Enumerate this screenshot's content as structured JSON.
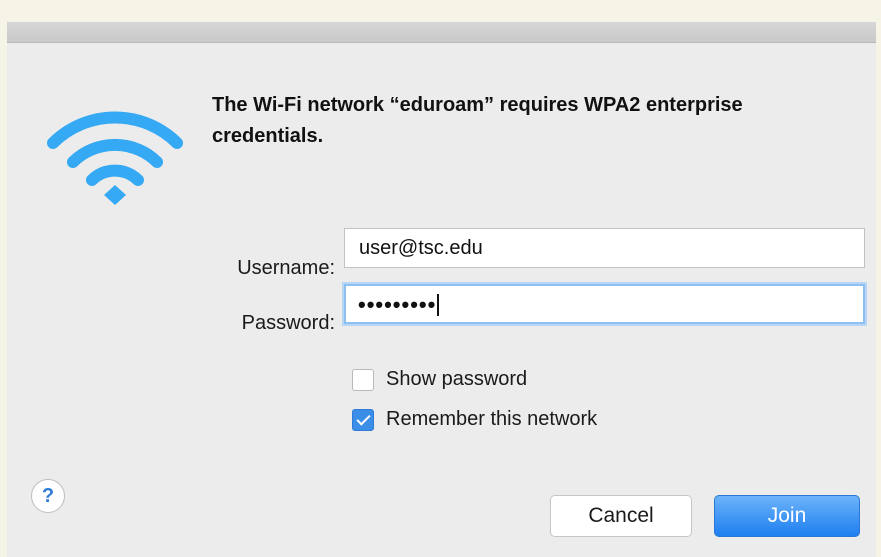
{
  "dialog": {
    "message": "The Wi-Fi network “eduroam” requires WPA2 enterprise credentials.",
    "icon": "wifi-icon"
  },
  "form": {
    "username_label": "Username:",
    "username_value": "user@tsc.edu",
    "password_label": "Password:",
    "password_masked": "•••••••••"
  },
  "options": {
    "show_password_label": "Show password",
    "show_password_checked": false,
    "remember_label": "Remember this network",
    "remember_checked": true
  },
  "buttons": {
    "help_label": "?",
    "cancel_label": "Cancel",
    "join_label": "Join"
  },
  "colors": {
    "accent": "#2f8af0",
    "focus_ring": "#8fbef0"
  }
}
